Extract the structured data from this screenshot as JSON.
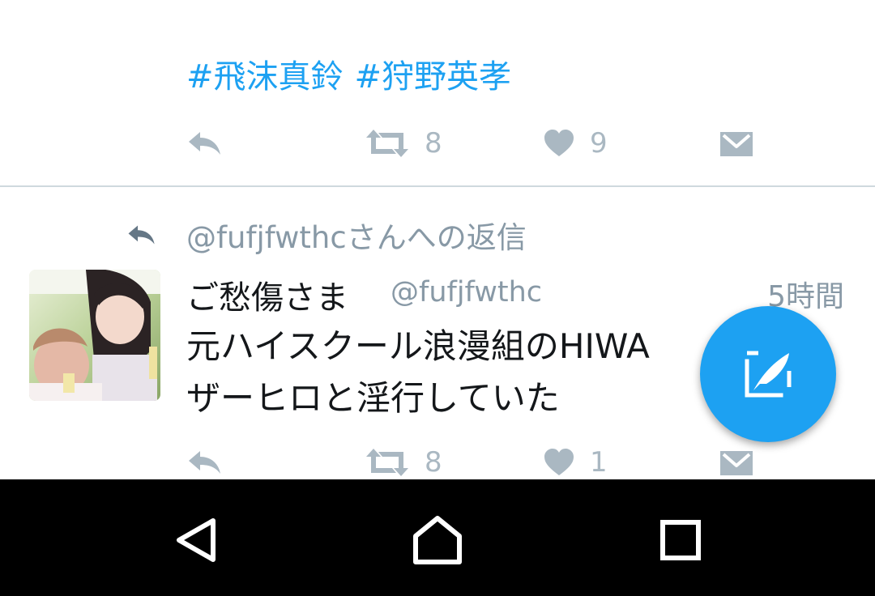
{
  "tweet1": {
    "hashtags": [
      "#飛沫真鈴",
      "#狩野英孝"
    ],
    "retweet_count": "8",
    "like_count": "9"
  },
  "tweet2": {
    "reply_context": "@fufjfwthcさんへの返信",
    "display_name": "ご愁傷さま",
    "handle": "@fufjfwthc",
    "timestamp": "5時間",
    "text_lines": [
      "元ハイスクール浪漫組のHIWA",
      "ザーヒロと淫行していた"
    ],
    "retweet_count": "8",
    "like_count": "1"
  },
  "icons": {
    "reply": "reply-icon",
    "retweet": "retweet-icon",
    "like": "heart-icon",
    "dm": "envelope-icon",
    "compose": "compose-tweet-icon",
    "back": "back-triangle-icon",
    "home": "home-icon",
    "recents": "recents-square-icon"
  },
  "colors": {
    "accent": "#1da1f2",
    "icon_gray": "#aab8c2",
    "text_primary": "#14171a",
    "text_secondary": "#8899a6",
    "navbar": "#000000"
  }
}
